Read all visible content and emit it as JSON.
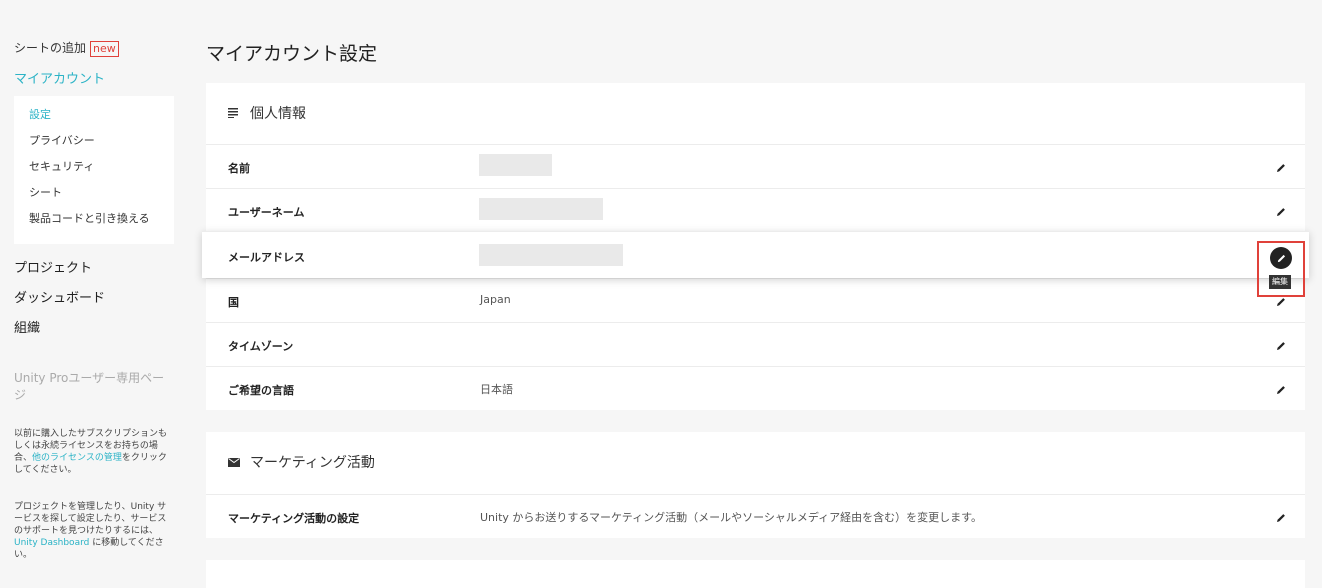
{
  "sidebar": {
    "add_seat": "シートの追加",
    "new_badge": "new",
    "my_account": "マイアカウント",
    "sub_items": [
      {
        "label": "設定",
        "active": true
      },
      {
        "label": "プライバシー"
      },
      {
        "label": "セキュリティ"
      },
      {
        "label": "シート"
      },
      {
        "label": "製品コードと引き換える"
      }
    ],
    "main_items": [
      "プロジェクト",
      "ダッシュボード",
      "組織"
    ],
    "pro_page": "Unity Proユーザー専用ページ",
    "note1_before": "以前に購入したサブスクリプションもしくは永続ライセンスをお持ちの場合、",
    "note1_link": "他のライセンスの管理",
    "note1_after": "をクリックしてください。",
    "note2_before": "プロジェクトを管理したり、Unity サービスを探して設定したり、サービスのサポートを見つけたりするには、",
    "note2_link": "Unity Dashboard",
    "note2_after": " に移動してください。"
  },
  "page": {
    "title": "マイアカウント設定"
  },
  "personal": {
    "heading": "個人情報",
    "rows": [
      {
        "label": "名前",
        "value": ""
      },
      {
        "label": "ユーザーネーム",
        "value": ""
      },
      {
        "label": "メールアドレス",
        "value": ""
      },
      {
        "label": "国",
        "value": "Japan"
      },
      {
        "label": "タイムゾーン",
        "value": ""
      },
      {
        "label": "ご希望の言語",
        "value": "日本語"
      }
    ],
    "tooltip": "編集"
  },
  "marketing": {
    "heading": "マーケティング活動",
    "row_label": "マーケティング活動の設定",
    "row_value": "Unity からお送りするマーケティング活動（メールやソーシャルメディア経由を含む）を変更します。"
  },
  "icons": {
    "personal_heading_icon": "list-icon",
    "marketing_heading_icon": "mail-icon",
    "edit_icon": "pencil-icon"
  },
  "colors": {
    "accent": "#2bb3c6",
    "highlight": "#e0413a"
  }
}
